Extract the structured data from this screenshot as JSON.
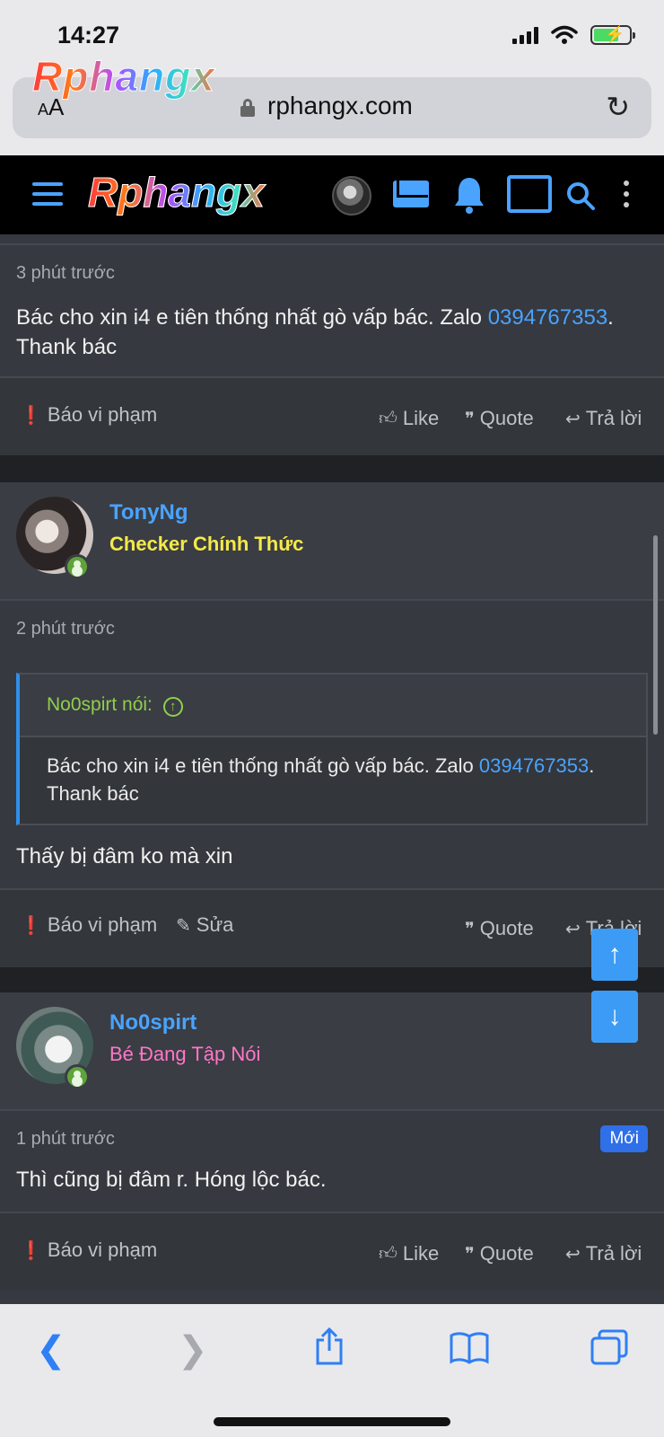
{
  "status_bar": {
    "time": "14:27"
  },
  "browser": {
    "logo_overlay": "Rphangx",
    "aa_label": "AA",
    "url": "rphangx.com"
  },
  "site_header": {
    "logo": "Rphangx"
  },
  "posts": [
    {
      "time": "3 phút trước",
      "body_prefix": "Bác cho xin i4 e tiên thống nhất gò vấp bác. Zalo ",
      "phone": "0394767353",
      "body_suffix": ". Thank bác",
      "report": "Báo vi phạm",
      "like": "Like",
      "quote": "Quote",
      "reply": "Trả lời"
    },
    {
      "username": "TonyNg",
      "user_title": "Checker Chính Thức",
      "time": "2 phút trước",
      "quote_author": "No0spirt nói:",
      "quote_prefix": "Bác cho xin i4 e tiên thống nhất gò vấp bác. Zalo ",
      "quote_phone": "0394767353",
      "quote_suffix": ". Thank bác",
      "body": "Thấy bị đâm ko mà xin",
      "report": "Báo vi phạm",
      "edit": "Sửa",
      "quote": "Quote",
      "reply": "Trả lời"
    },
    {
      "username": "No0spirt",
      "user_title": "Bé Đang Tập Nói",
      "time": "1 phút trước",
      "badge": "Mới",
      "body": "Thì cũng bị đâm r. Hóng lộc bác.",
      "report": "Báo vi phạm",
      "like": "Like",
      "quote": "Quote",
      "reply": "Trả lời"
    }
  ],
  "colors": {
    "accent": "#4aa3ff",
    "online": "#5fa33a",
    "title_yellow": "#f5e94a",
    "title_pink": "#ff77c8",
    "badge_new": "#2f6fe8"
  }
}
